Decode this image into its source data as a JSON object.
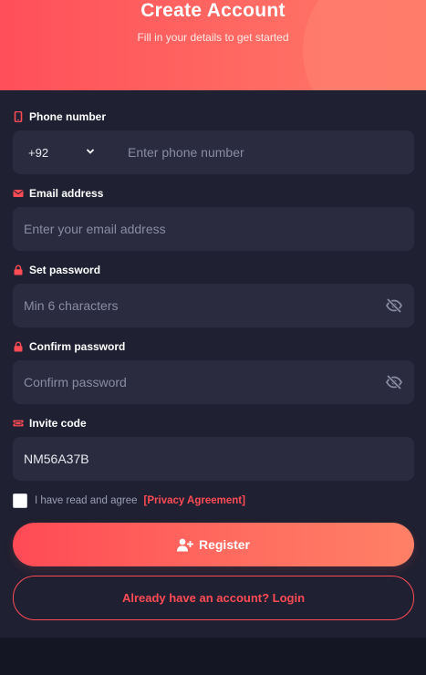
{
  "header": {
    "title": "Create Account",
    "subtitle": "Fill in your details to get started"
  },
  "phone": {
    "label": "Phone number",
    "country_code": "+92",
    "placeholder": "Enter phone number",
    "icon": "phone-icon"
  },
  "email": {
    "label": "Email address",
    "placeholder": "Enter your email address",
    "icon": "envelope-icon"
  },
  "password": {
    "label": "Set password",
    "placeholder": "Min 6 characters",
    "icon": "lock-icon"
  },
  "confirm_password": {
    "label": "Confirm password",
    "placeholder": "Confirm password",
    "icon": "lock-icon"
  },
  "invite": {
    "label": "Invite code",
    "value": "NM56A37B",
    "icon": "ticket-icon"
  },
  "agreement": {
    "text": "I have read and agree",
    "link": "[Privacy Agreement]",
    "checked": false
  },
  "buttons": {
    "register": "Register",
    "login": "Already have an account? Login"
  },
  "colors": {
    "accent": "#ff4b55",
    "background": "#151623",
    "panel": "#1f2031",
    "field": "#2a2b3e"
  }
}
